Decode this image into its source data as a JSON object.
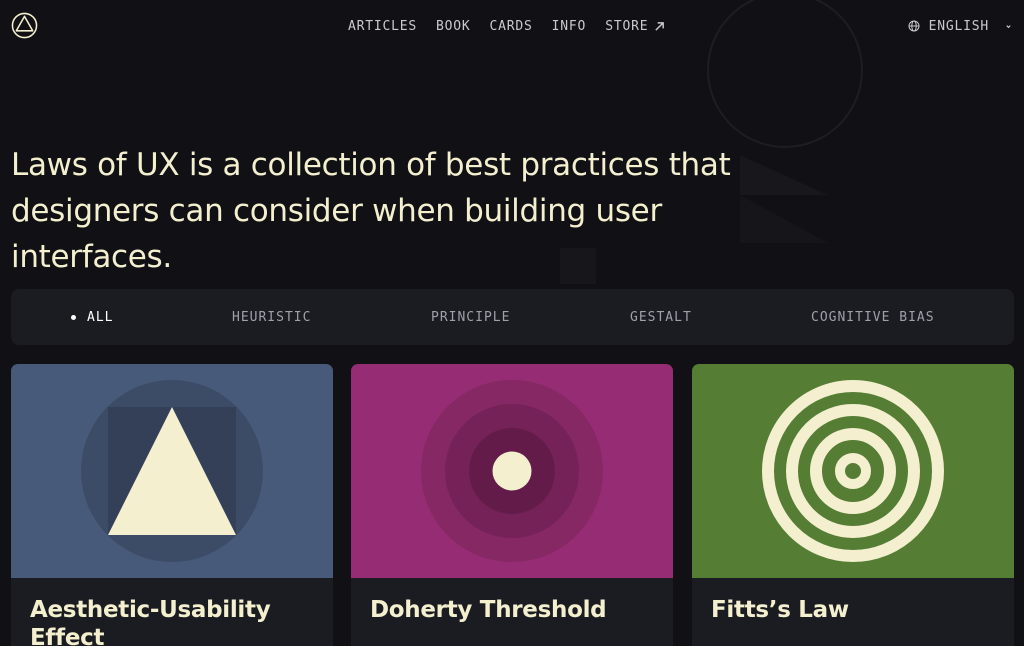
{
  "header": {
    "logo_icon": "triangle-in-circle-logo-icon",
    "nav": [
      {
        "label": "ARTICLES"
      },
      {
        "label": "BOOK"
      },
      {
        "label": "CARDS"
      },
      {
        "label": "INFO"
      },
      {
        "label": "STORE",
        "icon": "external-arrow-icon"
      }
    ],
    "language": {
      "label": "ENGLISH",
      "icon": "globe-icon",
      "caret": "chevron-down-icon"
    }
  },
  "hero": {
    "text": "Laws of UX is a collection of best practices that designers can consider when building user interfaces."
  },
  "filters": {
    "selected": "ALL",
    "items": [
      {
        "label": "ALL"
      },
      {
        "label": "HEURISTIC"
      },
      {
        "label": "PRINCIPLE"
      },
      {
        "label": "GESTALT"
      },
      {
        "label": "COGNITIVE BIAS"
      }
    ]
  },
  "cards": [
    {
      "title": "Aesthetic-Usability Effect",
      "color": "#475a79",
      "icon": "triangle-icon"
    },
    {
      "title": "Doherty Threshold",
      "color": "#962c73",
      "icon": "concentric-dot-icon"
    },
    {
      "title": "Fitts’s Law",
      "color": "#557d34",
      "icon": "target-rings-icon"
    }
  ],
  "colors": {
    "background": "#111115",
    "surface": "#1b1c21",
    "text": "#f3efcf",
    "nav_text": "#c9c9d0",
    "filter_text": "#9fa0aa"
  }
}
